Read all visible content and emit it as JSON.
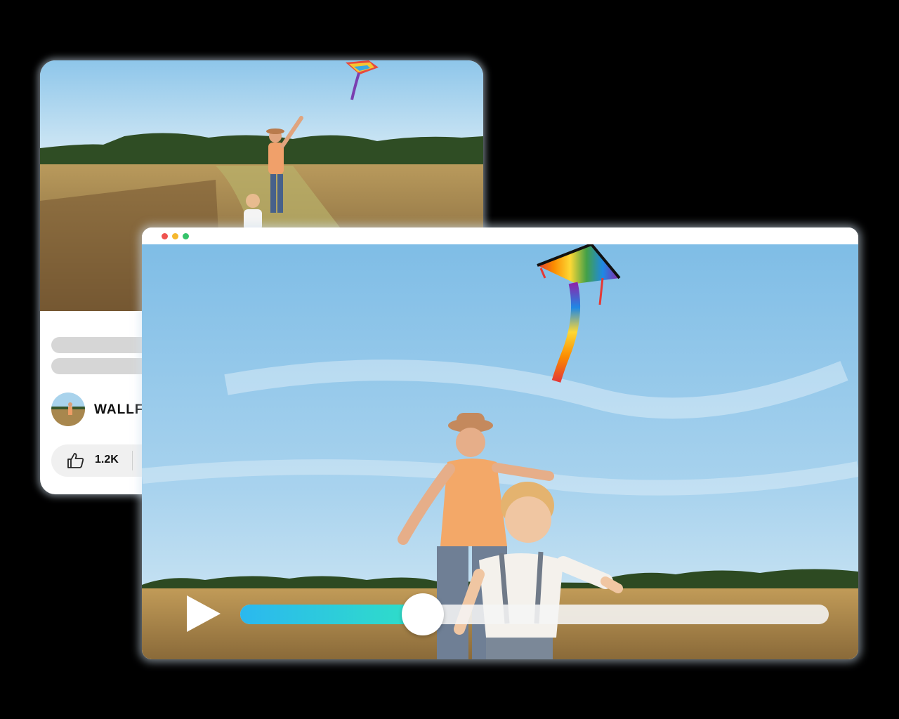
{
  "back_card": {
    "channel_name": "WALLF",
    "likes": "1.2K",
    "icons": {
      "like": "thumbs-up-icon"
    }
  },
  "player": {
    "progress": 0.31,
    "colors": {
      "progress_start": "#2bb8ef",
      "progress_end": "#2fe0c6",
      "dot_red": "#ef5350",
      "dot_yellow": "#f5b82e",
      "dot_green": "#35c36b"
    },
    "icons": {
      "play": "play-icon"
    }
  }
}
